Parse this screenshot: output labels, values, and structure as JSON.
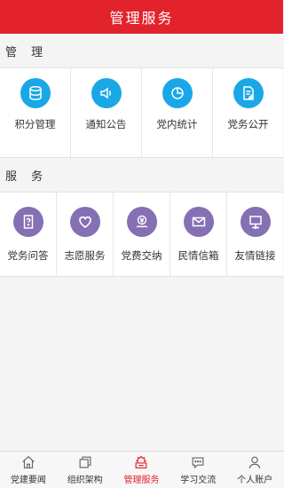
{
  "header": {
    "title": "管理服务"
  },
  "sections": {
    "manage": {
      "title": "管 理",
      "items": [
        {
          "label": "积分管理",
          "icon": "database-icon"
        },
        {
          "label": "通知公告",
          "icon": "speaker-icon"
        },
        {
          "label": "党内统计",
          "icon": "pie-chart-icon"
        },
        {
          "label": "党务公开",
          "icon": "document-edit-icon"
        }
      ]
    },
    "service": {
      "title": "服 务",
      "items": [
        {
          "label": "党务问答",
          "icon": "question-doc-icon"
        },
        {
          "label": "志愿服务",
          "icon": "heart-icon"
        },
        {
          "label": "党费交纳",
          "icon": "yuan-coin-icon"
        },
        {
          "label": "民情信箱",
          "icon": "mail-icon"
        },
        {
          "label": "友情链接",
          "icon": "monitor-link-icon"
        }
      ]
    }
  },
  "tabbar": {
    "items": [
      {
        "label": "党建要闻",
        "icon": "home-icon"
      },
      {
        "label": "组织架构",
        "icon": "layers-icon"
      },
      {
        "label": "管理服务",
        "icon": "service-icon",
        "active": true
      },
      {
        "label": "学习交流",
        "icon": "chat-icon"
      },
      {
        "label": "个人账户",
        "icon": "user-icon"
      }
    ]
  },
  "colors": {
    "brand_red": "#e3232c",
    "manage_icon_bg": "#1aa7e8",
    "service_icon_bg": "#8470b3"
  }
}
